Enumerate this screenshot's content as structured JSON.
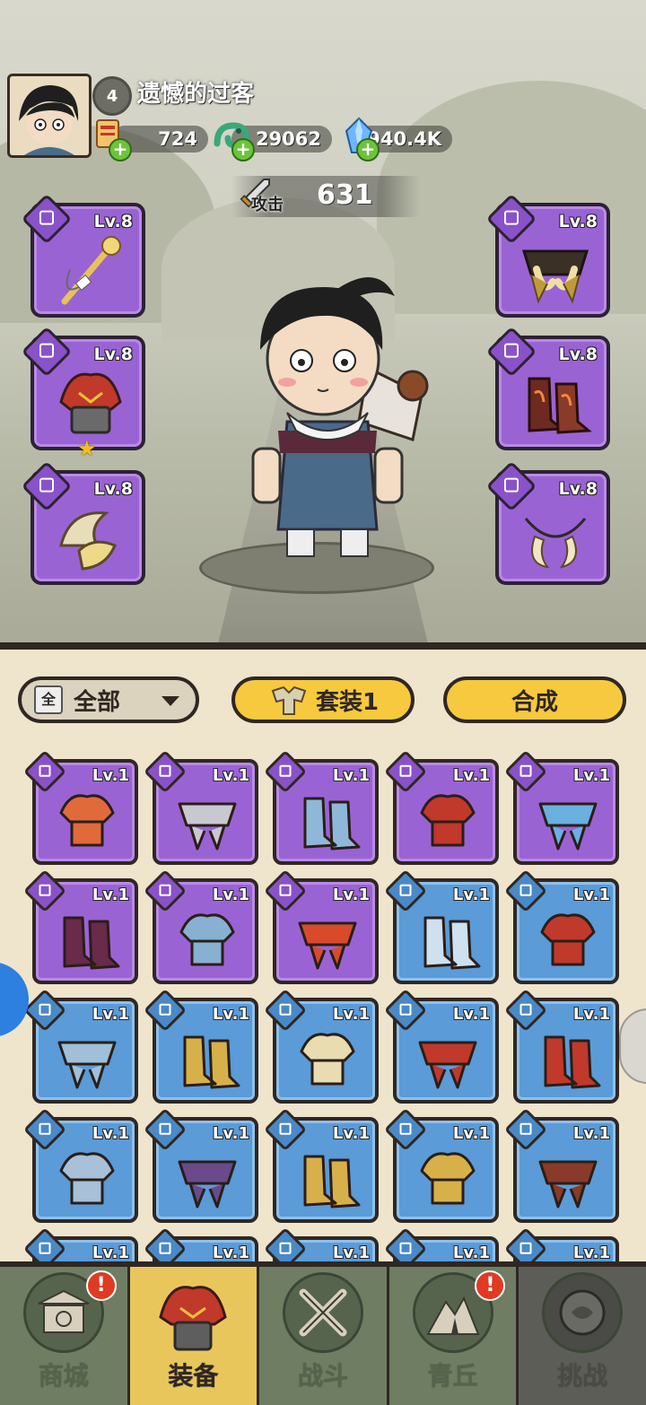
{
  "player": {
    "level": "4",
    "name": "遗憾的过客"
  },
  "resources": [
    {
      "icon": "coupon-icon",
      "value": "724"
    },
    {
      "icon": "jade-dragon-icon",
      "value": "29062"
    },
    {
      "icon": "crystal-icon",
      "value": "940.4K"
    }
  ],
  "attack": {
    "label": "攻击",
    "value": "631"
  },
  "equipped_left": [
    {
      "slot": "weapon",
      "level": "Lv.8",
      "icon": "golden-staff-icon"
    },
    {
      "slot": "helmet",
      "level": "Lv.8",
      "icon": "flame-helmet-icon",
      "star": "★"
    },
    {
      "slot": "shoulder",
      "level": "Lv.8",
      "icon": "fur-pauldron-icon"
    }
  ],
  "equipped_right": [
    {
      "slot": "belt",
      "level": "Lv.8",
      "icon": "horn-belt-icon"
    },
    {
      "slot": "boots",
      "level": "Lv.8",
      "icon": "flame-boots-icon"
    },
    {
      "slot": "necklace",
      "level": "Lv.8",
      "icon": "fang-necklace-icon"
    }
  ],
  "controls": {
    "filter_icon": "全",
    "filter_label": "全部",
    "set_label": "套装1",
    "merge_label": "合成"
  },
  "inventory": [
    {
      "rarity": "p",
      "level": "Lv.1",
      "icon": "flame-staff-icon"
    },
    {
      "rarity": "p",
      "level": "Lv.1",
      "icon": "stone-hammer-icon"
    },
    {
      "rarity": "p",
      "level": "Lv.1",
      "icon": "ice-helmet-icon"
    },
    {
      "rarity": "p",
      "level": "Lv.1",
      "icon": "flame-pauldron-icon"
    },
    {
      "rarity": "p",
      "level": "Lv.1",
      "icon": "ice-pauldron-icon"
    },
    {
      "rarity": "p",
      "level": "Lv.1",
      "icon": "dark-pauldron-icon"
    },
    {
      "rarity": "p",
      "level": "Lv.1",
      "icon": "ice-boots-icon"
    },
    {
      "rarity": "p",
      "level": "Lv.1",
      "icon": "flame-orb-icon"
    },
    {
      "rarity": "b",
      "level": "Lv.1",
      "icon": "bow-icon"
    },
    {
      "rarity": "b",
      "level": "Lv.1",
      "icon": "flame-helmet-icon"
    },
    {
      "rarity": "b",
      "level": "Lv.1",
      "icon": "ice-helmet-icon"
    },
    {
      "rarity": "b",
      "level": "Lv.1",
      "icon": "golden-armor-icon"
    },
    {
      "rarity": "b",
      "level": "Lv.1",
      "icon": "fur-pauldron-icon"
    },
    {
      "rarity": "b",
      "level": "Lv.1",
      "icon": "flame-belt-icon"
    },
    {
      "rarity": "b",
      "level": "Lv.1",
      "icon": "flame-belt-icon"
    },
    {
      "rarity": "b",
      "level": "Lv.1",
      "icon": "ice-belt-icon"
    },
    {
      "rarity": "b",
      "level": "Lv.1",
      "icon": "dark-belt-icon"
    },
    {
      "rarity": "b",
      "level": "Lv.1",
      "icon": "horn-belt-icon"
    },
    {
      "rarity": "b",
      "level": "Lv.1",
      "icon": "horn-belt-icon"
    },
    {
      "rarity": "b",
      "level": "Lv.1",
      "icon": "flame-boots-icon"
    },
    {
      "rarity": "b",
      "level": "Lv.1",
      "icon": "boots-icon"
    },
    {
      "rarity": "b",
      "level": "Lv.1",
      "icon": "boots-icon"
    },
    {
      "rarity": "b",
      "level": "Lv.1",
      "icon": "boots-icon"
    },
    {
      "rarity": "b",
      "level": "Lv.1",
      "icon": "necklace-icon"
    },
    {
      "rarity": "b",
      "level": "Lv.1",
      "icon": "necklace-icon"
    }
  ],
  "nav": [
    {
      "label": "商城",
      "icon": "shop-icon",
      "badge": "!"
    },
    {
      "label": "装备",
      "icon": "helmet-icon",
      "active": true
    },
    {
      "label": "战斗",
      "icon": "crossed-swords-icon"
    },
    {
      "label": "青丘",
      "icon": "mountain-icon",
      "badge": "!"
    },
    {
      "label": "挑战",
      "icon": "locked-orb-icon"
    }
  ],
  "colors": {
    "epic": "#9a63d4",
    "rare": "#5a9bd8",
    "accent": "#f6c93e",
    "nav": "#6f7d62"
  }
}
